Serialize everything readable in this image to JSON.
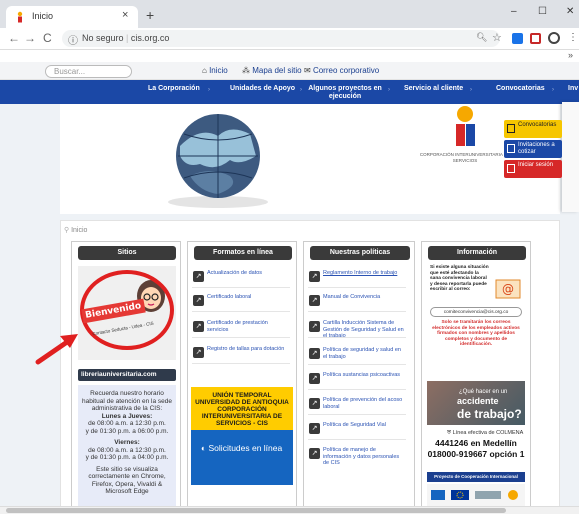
{
  "browser": {
    "tab_title": "Inicio",
    "tab_close": "×",
    "new_tab": "+",
    "window_controls": [
      "–",
      "☐",
      "✕"
    ],
    "nav_buttons": [
      "←",
      "→",
      "C"
    ],
    "url_security": "No seguro",
    "url_host": "cis.org.co",
    "bookmarks_more": "»"
  },
  "site": {
    "search_placeholder": "Buscar...",
    "top_links": [
      "Inicio",
      "Mapa del sitio",
      "Correo corporativo"
    ],
    "nav": [
      "La Corporación",
      "Unidades de Apoyo",
      "Algunos proyectos en ejecución",
      "Servicio al cliente",
      "Convocatorias",
      "Inv"
    ],
    "logo_caption": "CORPORACIÓN INTERUNIVERSITARIA DE SERVICIOS",
    "side_buttons": [
      {
        "label": "Convocatorias",
        "color": "#f6c600"
      },
      {
        "label": "Invitaciones a cotizar",
        "color": "#1b48a6"
      },
      {
        "label": "Iniciar sesión",
        "color": "#d62828"
      }
    ],
    "breadcrumb": "Inicio"
  },
  "columns": {
    "sitios": {
      "title": "Sitios",
      "promo_title": "Bienvenido",
      "promo_sub": "Contacto Seducta - Udea - CIS",
      "library": "libreriauniversitaria.com",
      "hours": {
        "intro": "Recuerda nuestro horario habitual de atención en la sede administrativa de la CIS:",
        "weekdays_title": "Lunes a Jueves:",
        "weekdays_1": "de 08:00 a.m. a 12:30 p.m.",
        "weekdays_2": "y de 01:30 p.m. a 06:00 p.m.",
        "friday_title": "Viernes:",
        "friday_1": "de 08:00 a.m. a 12:30 p.m.",
        "friday_2": "y de 01:30 p.m. a 04:00 p.m.",
        "browsers": "Este sitio se visualiza correctamente en Chrome, Firefox, Opera, Vivaldi & Microsoft Edge"
      }
    },
    "formatos": {
      "title": "Formatos en línea",
      "links": [
        "Actualización de datos",
        "Certificado laboral",
        "Certificado de prestación servicios",
        "Registro de tallas para dotación"
      ],
      "union_title": "UNIÓN TEMPORAL UNIVERSIDAD DE ANTIOQUIA CORPORACIÓN INTERUNIVERSITARIA DE SERVICIOS - CIS",
      "union_button": "Solicitudes en línea"
    },
    "politicas": {
      "title": "Nuestras políticas",
      "links": [
        "Reglamento Interno de trabajo",
        "Manual de Convivencia",
        "Cartilla Inducción Sistema de Gestión de Seguridad y Salud en el trabajo",
        "Política de seguridad y salud en el trabajo",
        "Política sustancias psicoactivas",
        "Política de prevención del acoso laboral",
        "Política de Seguridad Vial",
        "Política de manejo de información y datos personales de CIS"
      ]
    },
    "informacion": {
      "title": "Información",
      "notice": "Si existe alguna situación que esté afectando la sana convivencia laboral y desea reportarla puede escribir al correo:",
      "email": "comiteconvivencia@cis.org.co",
      "notice2": "Solo se tramitarán los correos electrónicos de los empleados activos firmados con nombres y apellidos completos y documento de identificación.",
      "accident_1": "¿Qué hacer en un",
      "accident_2": "accidente",
      "accident_3": "de trabajo?",
      "colmena_line": "Línea efectiva de COLMENA",
      "phone_1": "4441246 en Medellín",
      "phone_2": "018000-919667 opción 1",
      "cooperation": "Proyecto de Cooperación Internacional"
    }
  }
}
